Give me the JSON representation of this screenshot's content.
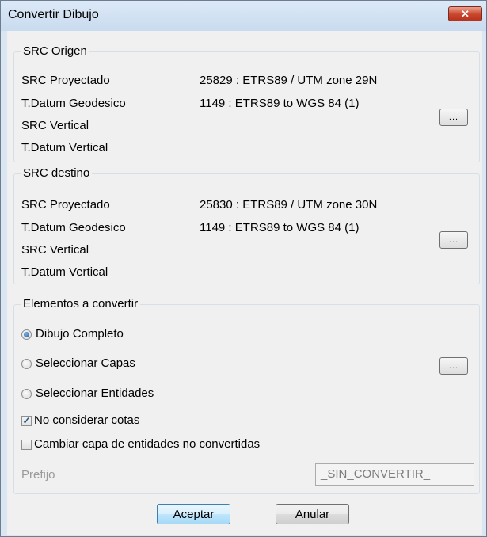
{
  "window": {
    "title": "Convertir Dibujo",
    "close_label": "x"
  },
  "origen": {
    "legend": "SRC Origen",
    "rows": [
      {
        "label": "SRC Proyectado",
        "value": "25829 : ETRS89 / UTM zone 29N"
      },
      {
        "label": "T.Datum Geodesico",
        "value": "1149 : ETRS89 to WGS 84 (1)"
      },
      {
        "label": "SRC Vertical",
        "value": ""
      },
      {
        "label": "T.Datum Vertical",
        "value": ""
      }
    ],
    "button": "..."
  },
  "destino": {
    "legend": "SRC destino",
    "rows": [
      {
        "label": "SRC Proyectado",
        "value": "25830 : ETRS89 / UTM zone 30N"
      },
      {
        "label": "T.Datum Geodesico",
        "value": "1149 : ETRS89 to WGS 84 (1)"
      },
      {
        "label": "SRC Vertical",
        "value": ""
      },
      {
        "label": "T.Datum Vertical",
        "value": ""
      }
    ],
    "button": "..."
  },
  "elementos": {
    "legend": "Elementos a convertir",
    "radios": [
      {
        "label": "Dibujo Completo",
        "checked": true
      },
      {
        "label": "Seleccionar Capas",
        "checked": false
      },
      {
        "label": "Seleccionar Entidades",
        "checked": false
      }
    ],
    "capas_button": "...",
    "checkboxes": [
      {
        "label": "No considerar cotas",
        "checked": true
      },
      {
        "label": "Cambiar capa de entidades no convertidas",
        "checked": false
      }
    ],
    "prefijo_label": "Prefijo",
    "prefijo_value": "_SIN_CONVERTIR_"
  },
  "buttons": {
    "ok": "Aceptar",
    "cancel": "Anular"
  },
  "colors": {
    "titlebar": "#dce9f7",
    "client": "#f0f0f0",
    "close": "#c9452b",
    "default_button": "#bee6fd"
  }
}
